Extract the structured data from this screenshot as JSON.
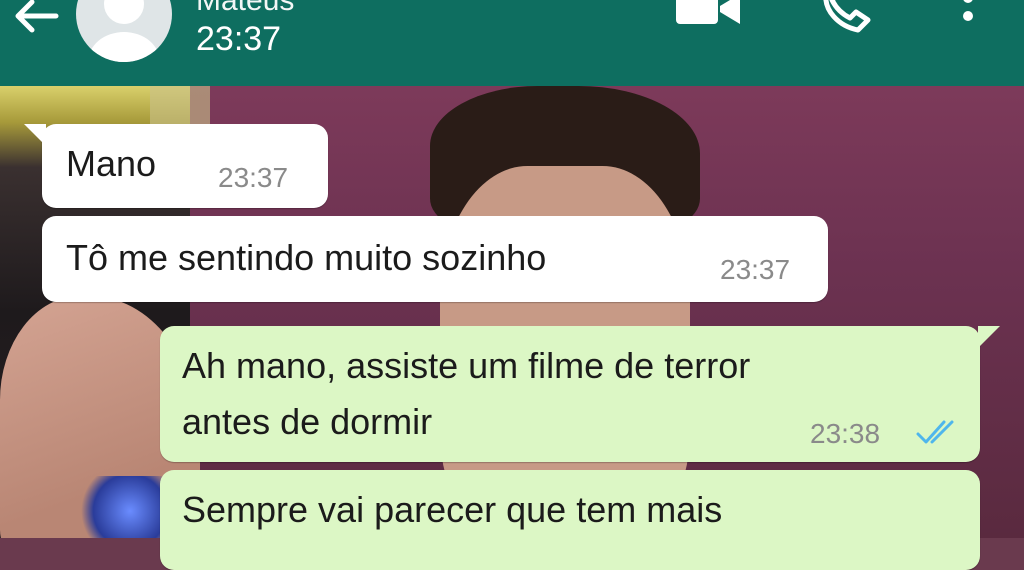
{
  "header": {
    "contact_name": "Mateus",
    "status": "23:37",
    "icons": [
      "back-arrow-icon",
      "avatar-placeholder-icon",
      "video-call-icon",
      "phone-icon",
      "more-vert-icon"
    ],
    "bg_color": "#0e6e60"
  },
  "messages": [
    {
      "direction": "incoming",
      "text": "Mano",
      "time": "23:37"
    },
    {
      "direction": "incoming",
      "text": "Tô me sentindo muito sozinho",
      "time": "23:37"
    },
    {
      "direction": "outgoing",
      "text_line1": "Ah mano, assiste um filme de terror",
      "text_line2": "antes de dormir",
      "time": "23:38",
      "status": "read"
    },
    {
      "direction": "outgoing",
      "text": "Sempre vai parecer que tem mais"
    }
  ],
  "colors": {
    "incoming_bubble": "#ffffff",
    "outgoing_bubble": "#dcf7c5",
    "read_ticks": "#4fb6ec",
    "timestamp": "#8a8a8a"
  }
}
